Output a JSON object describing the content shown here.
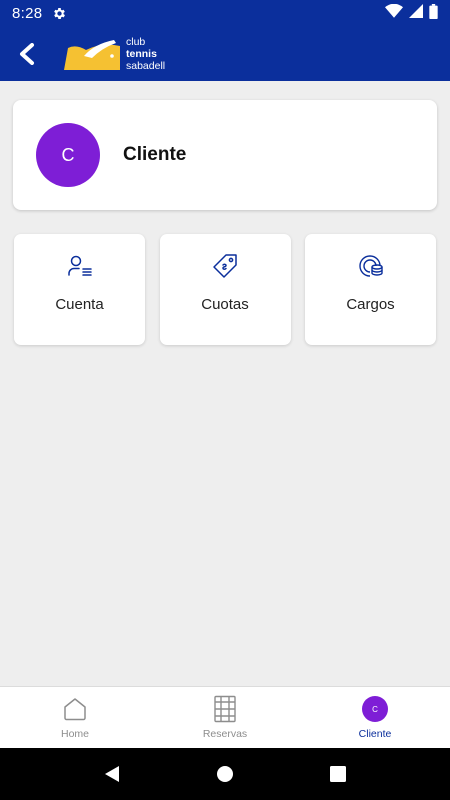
{
  "status_bar": {
    "time": "8:28"
  },
  "header": {
    "logo_lines": [
      "club",
      "tennis",
      "sabadell"
    ]
  },
  "profile": {
    "initial": "C",
    "name": "Cliente"
  },
  "tiles": [
    {
      "label": "Cuenta",
      "icon": "account-icon"
    },
    {
      "label": "Cuotas",
      "icon": "fee-tag-icon"
    },
    {
      "label": "Cargos",
      "icon": "charges-coins-icon"
    }
  ],
  "bottom_nav": {
    "items": [
      {
        "label": "Home",
        "icon": "home-icon",
        "active": false
      },
      {
        "label": "Reservas",
        "icon": "reservations-icon",
        "active": false
      },
      {
        "label": "Cliente",
        "icon": "client-avatar-icon",
        "active": true,
        "initial": "C"
      }
    ]
  },
  "colors": {
    "primary": "#0b2f9c",
    "avatar": "#7e1ed6",
    "background": "#eeeeee",
    "inactive_nav": "#8d8d8d"
  }
}
